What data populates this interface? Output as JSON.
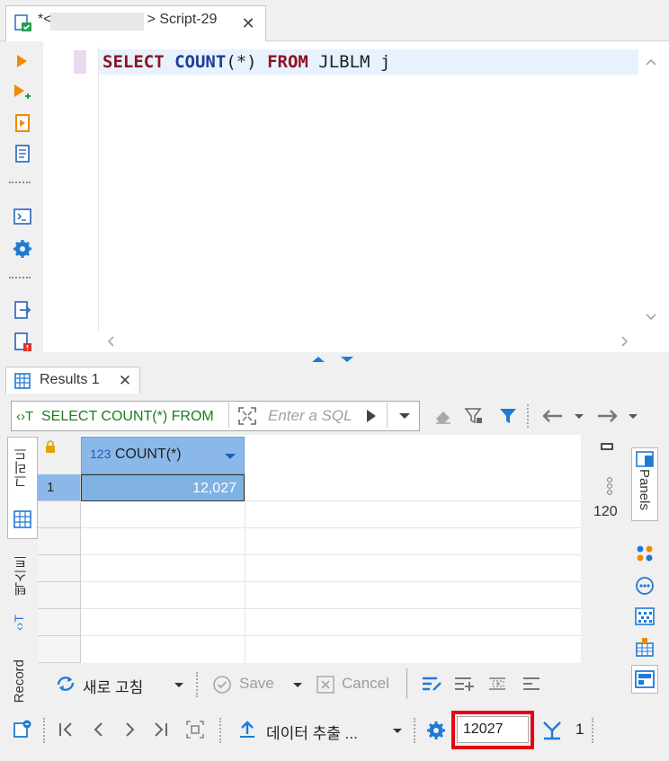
{
  "editor_tab": {
    "prefix": "*<",
    "suffix": "> Script-29",
    "close": "✕"
  },
  "editor": {
    "sql": {
      "select": "SELECT",
      "count": "COUNT",
      "args": "(*)",
      "from": "FROM",
      "table": "JLBLM j"
    }
  },
  "results_tab": {
    "label": "Results 1",
    "close": "✕"
  },
  "filter": {
    "query_text": "SELECT COUNT(*) FROM",
    "placeholder": "Enter a SQL"
  },
  "side_tabs": {
    "grid": "그리드",
    "text": "텍스트",
    "record": "Record"
  },
  "grid": {
    "column": {
      "type_badge": "123",
      "name": "COUNT(*)"
    },
    "rows": [
      {
        "num": "1",
        "value": "12,027"
      }
    ]
  },
  "right_panel": {
    "tab_label": "Panels",
    "value_preview": "120"
  },
  "toolbar1": {
    "refresh": "새로 고침",
    "save": "Save",
    "cancel": "Cancel"
  },
  "toolbar2": {
    "export": "데이터 추출 ...",
    "fetch_size": "12027",
    "count": "1"
  },
  "colors": {
    "accent_blue": "#1f7ad6",
    "keyword": "#8b1424",
    "function": "#1d3d9b",
    "header_blue": "#8ab9e9",
    "highlight": "#e60012",
    "orange": "#f08a00",
    "green": "#1b7d1b"
  }
}
